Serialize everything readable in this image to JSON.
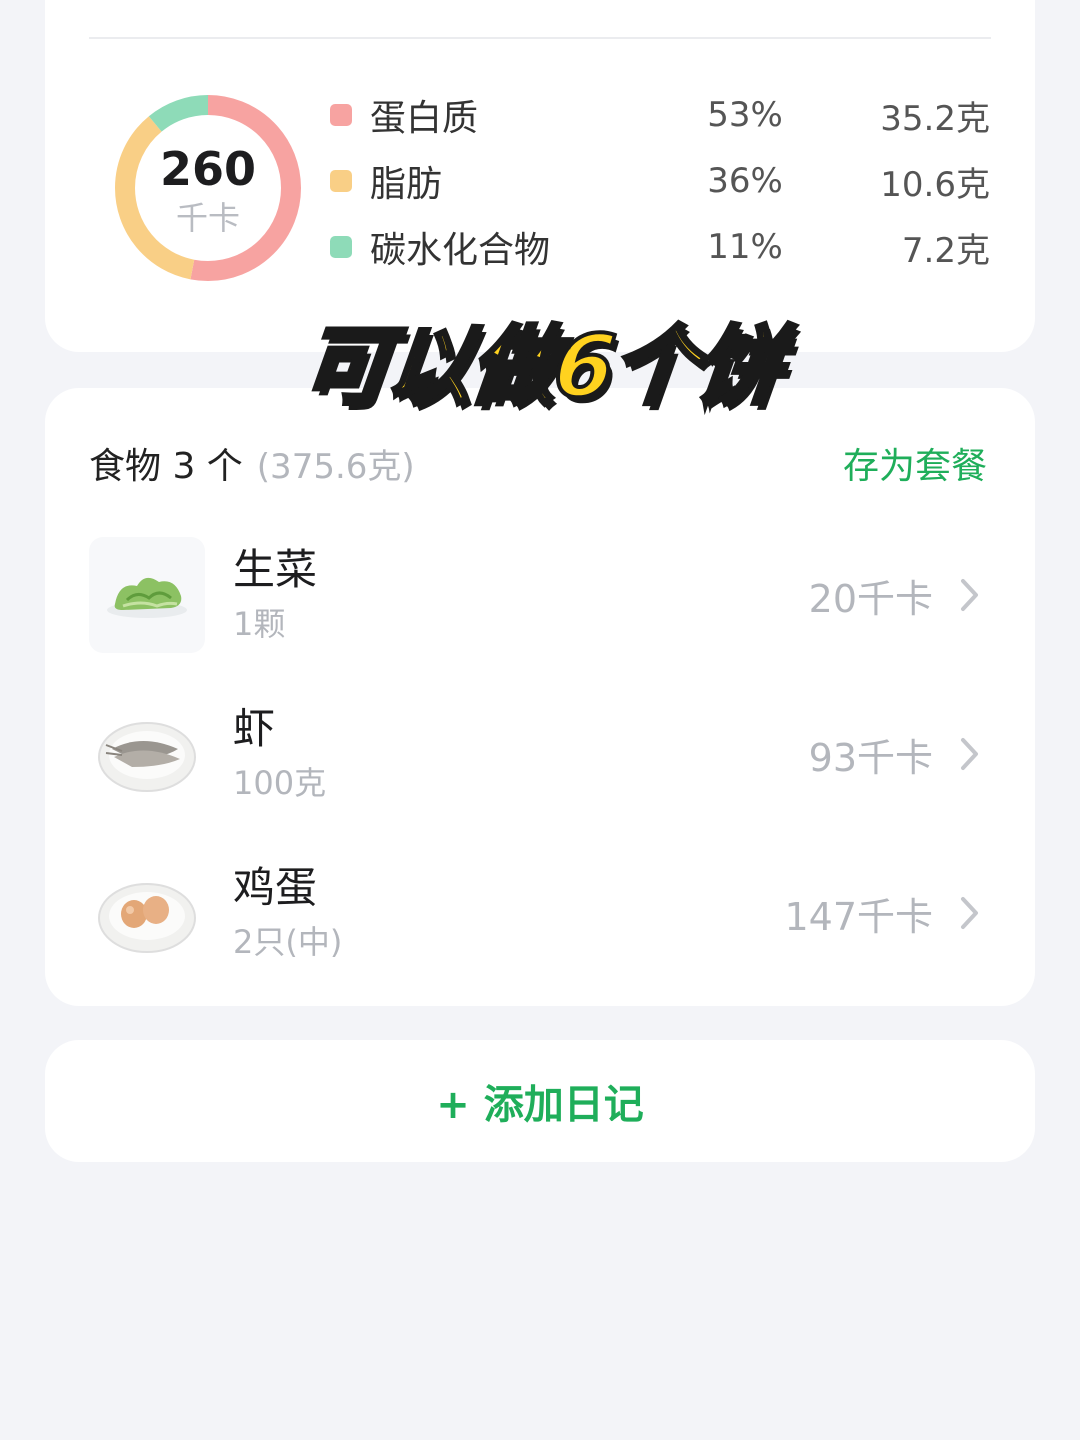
{
  "nutrition": {
    "calories_value": "260",
    "calories_unit": "千卡",
    "macros": [
      {
        "name": "蛋白质",
        "percent": "53%",
        "amount": "35.2克",
        "color": "#f7a3a1",
        "share": 0.53
      },
      {
        "name": "脂肪",
        "percent": "36%",
        "amount": "10.6克",
        "color": "#f9cf86",
        "share": 0.36
      },
      {
        "name": "碳水化合物",
        "percent": "11%",
        "amount": "7.2克",
        "color": "#8edbb8",
        "share": 0.11
      }
    ]
  },
  "overlay_caption": "可以做6个饼",
  "foods": {
    "count_label": "食物 3 个",
    "total_weight": "(375.6克)",
    "save_set_label": "存为套餐",
    "items": [
      {
        "name": "生菜",
        "quantity": "1颗",
        "calories": "20千卡",
        "icon": "lettuce-icon"
      },
      {
        "name": "虾",
        "quantity": "100克",
        "calories": "93千卡",
        "icon": "shrimp-icon"
      },
      {
        "name": "鸡蛋",
        "quantity": "2只(中)",
        "calories": "147千卡",
        "icon": "eggs-icon"
      }
    ]
  },
  "add_diary_label": "+ 添加日记",
  "colors": {
    "accent": "#1fae5a",
    "background": "#f3f4f8"
  }
}
